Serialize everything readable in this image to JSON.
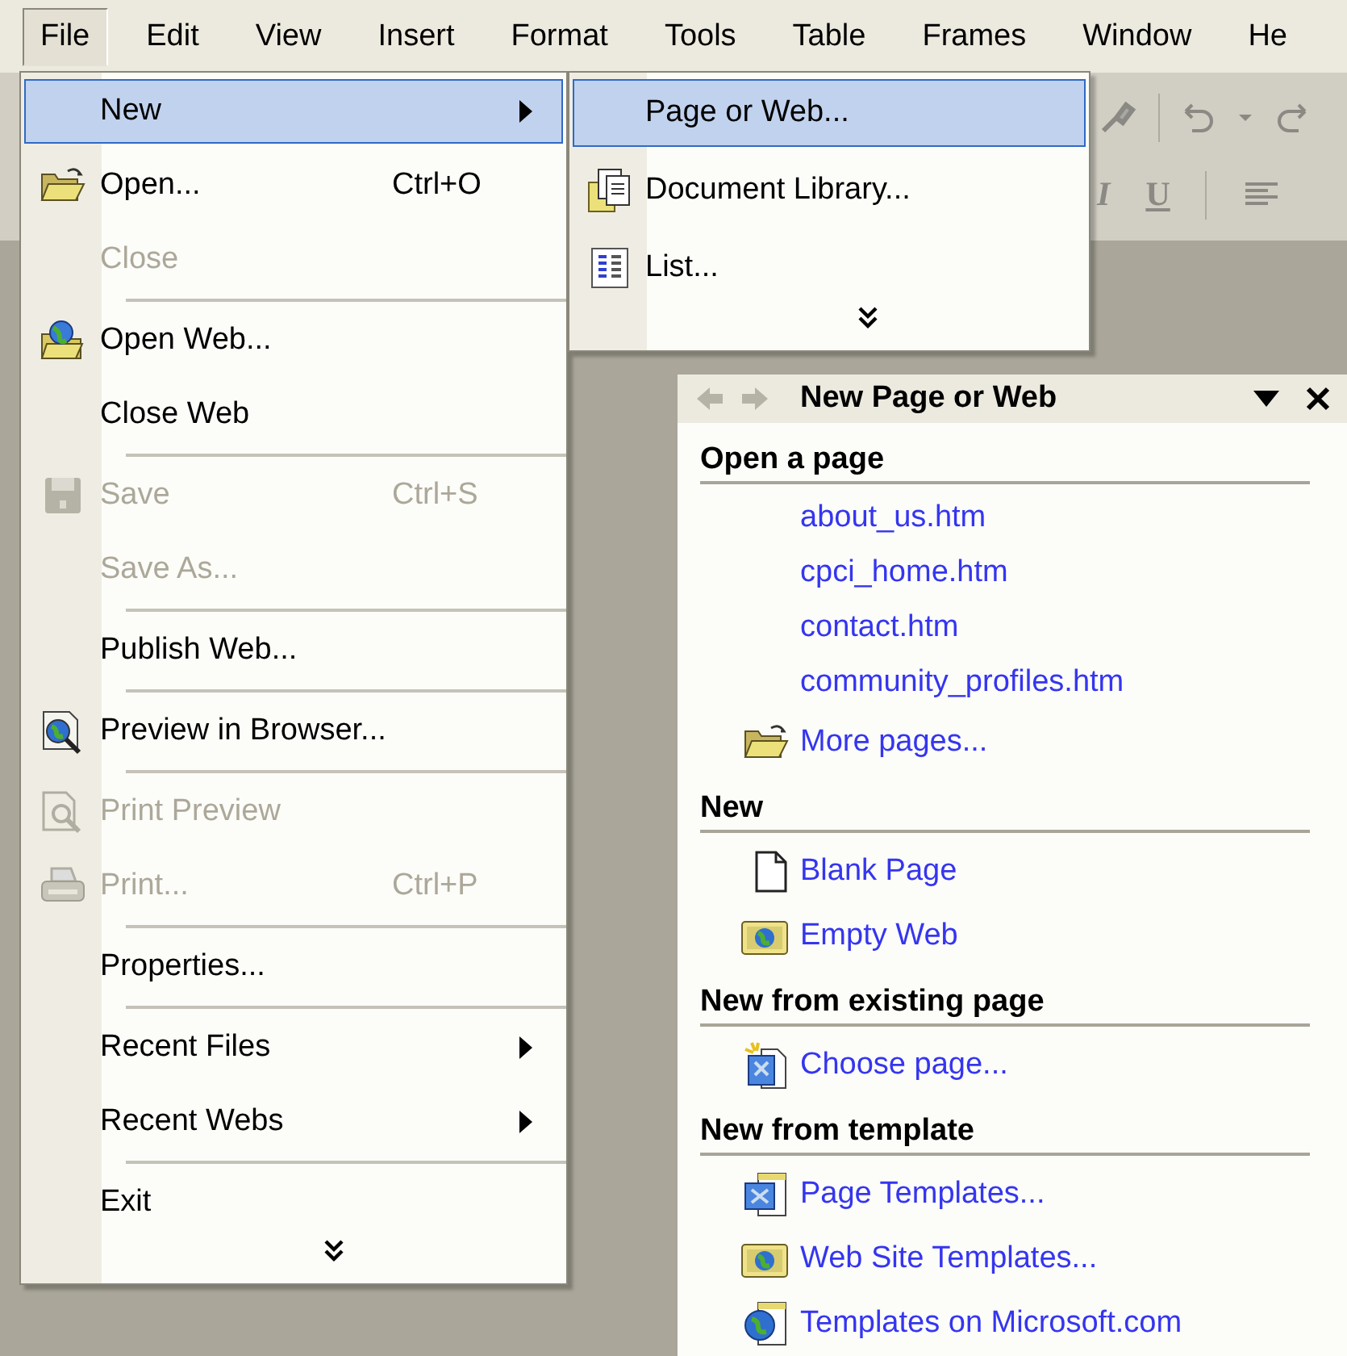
{
  "menu_bar": [
    {
      "label": "File",
      "selected": true
    },
    {
      "label": "Edit",
      "selected": false
    },
    {
      "label": "View",
      "selected": false
    },
    {
      "label": "Insert",
      "selected": false
    },
    {
      "label": "Format",
      "selected": false
    },
    {
      "label": "Tools",
      "selected": false
    },
    {
      "label": "Table",
      "selected": false
    },
    {
      "label": "Frames",
      "selected": false
    },
    {
      "label": "Window",
      "selected": false
    },
    {
      "label": "He",
      "selected": false
    }
  ],
  "toolbar": {
    "buttons": [
      {
        "label": "I",
        "kind": "italic"
      },
      {
        "label": "U",
        "kind": "underline"
      }
    ]
  },
  "file_menu": {
    "items": [
      {
        "kind": "item",
        "label": "New",
        "selected": true,
        "disabled": false,
        "submenu": true
      },
      {
        "kind": "item",
        "label": "Open...",
        "shortcut": "Ctrl+O",
        "selected": false,
        "disabled": false,
        "submenu": false
      },
      {
        "kind": "item",
        "label": "Close",
        "selected": false,
        "disabled": true,
        "submenu": false
      },
      {
        "kind": "separator"
      },
      {
        "kind": "item",
        "label": "Open Web...",
        "selected": false,
        "disabled": false,
        "submenu": false
      },
      {
        "kind": "item",
        "label": "Close Web",
        "selected": false,
        "disabled": false,
        "submenu": false
      },
      {
        "kind": "separator"
      },
      {
        "kind": "item",
        "label": "Save",
        "shortcut": "Ctrl+S",
        "selected": false,
        "disabled": true,
        "submenu": false
      },
      {
        "kind": "item",
        "label": "Save As...",
        "selected": false,
        "disabled": true,
        "submenu": false
      },
      {
        "kind": "separator"
      },
      {
        "kind": "item",
        "label": "Publish Web...",
        "selected": false,
        "disabled": false,
        "submenu": false
      },
      {
        "kind": "separator"
      },
      {
        "kind": "item",
        "label": "Preview in Browser...",
        "selected": false,
        "disabled": false,
        "submenu": false
      },
      {
        "kind": "separator"
      },
      {
        "kind": "item",
        "label": "Print Preview",
        "selected": false,
        "disabled": true,
        "submenu": false
      },
      {
        "kind": "item",
        "label": "Print...",
        "shortcut": "Ctrl+P",
        "selected": false,
        "disabled": true,
        "submenu": false
      },
      {
        "kind": "separator"
      },
      {
        "kind": "item",
        "label": "Properties...",
        "selected": false,
        "disabled": false,
        "submenu": false
      },
      {
        "kind": "separator"
      },
      {
        "kind": "item",
        "label": "Recent Files",
        "selected": false,
        "disabled": false,
        "submenu": true
      },
      {
        "kind": "item",
        "label": "Recent Webs",
        "selected": false,
        "disabled": false,
        "submenu": true
      },
      {
        "kind": "separator"
      },
      {
        "kind": "item",
        "label": "Exit",
        "selected": false,
        "disabled": false,
        "submenu": false
      },
      {
        "kind": "expand"
      }
    ]
  },
  "new_submenu": {
    "items": [
      {
        "kind": "item",
        "label": "Page or Web...",
        "selected": true,
        "disabled": false,
        "submenu": false
      },
      {
        "kind": "item",
        "label": "Document Library...",
        "selected": false,
        "disabled": false,
        "submenu": false
      },
      {
        "kind": "item",
        "label": "List...",
        "selected": false,
        "disabled": false,
        "submenu": false
      },
      {
        "kind": "expand"
      }
    ]
  },
  "task_pane": {
    "title": "New Page or Web",
    "sections": [
      {
        "heading": "Open a page",
        "items": [
          {
            "label": "about_us.htm"
          },
          {
            "label": "cpci_home.htm"
          },
          {
            "label": "contact.htm"
          },
          {
            "label": "community_profiles.htm"
          },
          {
            "label": "More pages..."
          }
        ]
      },
      {
        "heading": "New",
        "items": [
          {
            "label": "Blank Page"
          },
          {
            "label": "Empty Web"
          }
        ]
      },
      {
        "heading": "New from existing page",
        "items": [
          {
            "label": "Choose page..."
          }
        ]
      },
      {
        "heading": "New from template",
        "items": [
          {
            "label": "Page Templates..."
          },
          {
            "label": "Web Site Templates..."
          },
          {
            "label": "Templates on Microsoft.com"
          }
        ]
      }
    ]
  }
}
